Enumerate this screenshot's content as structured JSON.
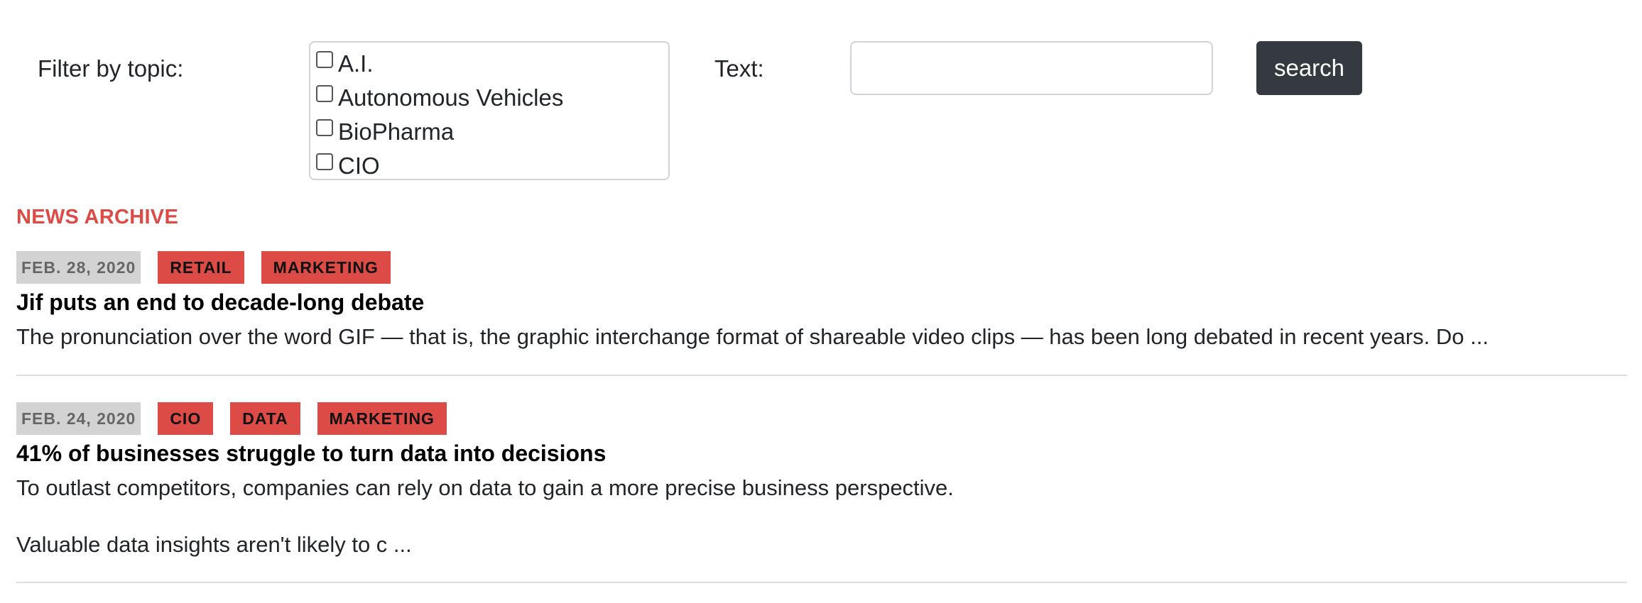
{
  "filter": {
    "label": "Filter by topic:",
    "topics": [
      {
        "label": "A.I.",
        "checked": false
      },
      {
        "label": "Autonomous Vehicles",
        "checked": false
      },
      {
        "label": "BioPharma",
        "checked": false
      },
      {
        "label": "CIO",
        "checked": false
      }
    ],
    "text_label": "Text:",
    "text_value": "",
    "text_placeholder": "",
    "search_label": "search"
  },
  "archive": {
    "heading": "NEWS ARCHIVE",
    "articles": [
      {
        "date": "FEB. 28, 2020",
        "tags": [
          "RETAIL",
          "MARKETING"
        ],
        "title": "Jif puts an end to decade-long debate",
        "excerpt": "The pronunciation over the word GIF — that is, the graphic interchange format of shareable video clips — has been long debated in recent years. Do ...",
        "excerpt_2": ""
      },
      {
        "date": "FEB. 24, 2020",
        "tags": [
          "CIO",
          "DATA",
          "MARKETING"
        ],
        "title": "41% of businesses struggle to turn data into decisions",
        "excerpt": "To outlast competitors, companies can rely on data to gain a more precise business perspective.",
        "excerpt_2": "Valuable data insights aren't likely to c ..."
      }
    ]
  },
  "colors": {
    "accent": "#dc4b46",
    "button": "#343a40",
    "date_badge": "#d3d3d3"
  }
}
